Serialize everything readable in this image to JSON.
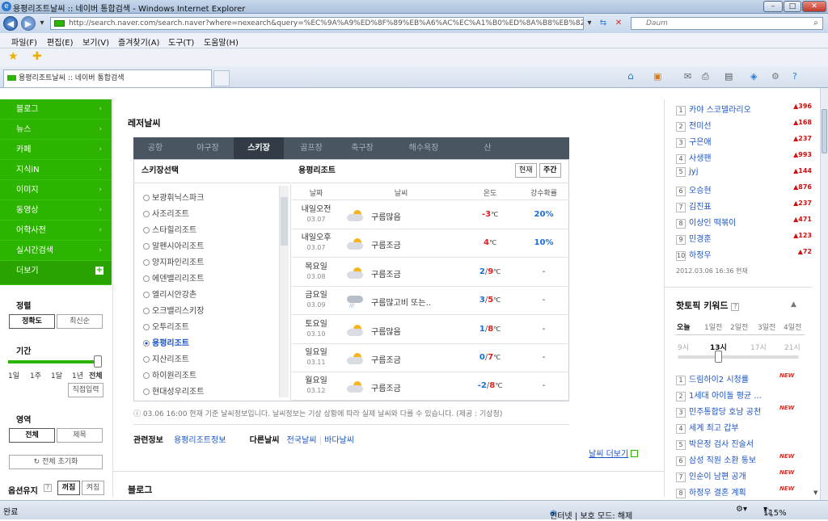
{
  "window": {
    "title": "용평리조트날씨 :: 네이버 통합검색 - Windows Internet Explorer",
    "min": "–",
    "max": "□",
    "close": "✕"
  },
  "address": {
    "url": "http://search.naver.com/search.naver?where=nexearch&query=%EC%9A%A9%ED%8F%89%EB%A6%AC%EC%A1%B0%ED%8A%B8%EB%82%A0%EC%94%A8",
    "search_placeholder": "Daum"
  },
  "menu": [
    "파일(F)",
    "편집(E)",
    "보기(V)",
    "즐겨찾기(A)",
    "도구(T)",
    "도움말(H)"
  ],
  "tab": {
    "label": "용평리조트날씨 :: 네이버 통합검색"
  },
  "left_nav": {
    "items": [
      "블로그",
      "뉴스",
      "카페",
      "지식iN",
      "이미지",
      "동영상",
      "어학사전",
      "실시간검색"
    ],
    "more": "더보기",
    "sort_title": "정렬",
    "sort_options": [
      "정확도",
      "최신순"
    ],
    "period_title": "기간",
    "period_ticks": [
      "1일",
      "1주",
      "1달",
      "1년",
      "전체"
    ],
    "direct_input": "직접입력",
    "area_title": "영역",
    "area_options": [
      "전체",
      "제목"
    ],
    "reset": "전체 초기화",
    "option_keep": "옵션유지",
    "option_off": "꺼짐",
    "option_on": "켜짐"
  },
  "leisure": {
    "title": "레저날씨",
    "tabs": [
      "공항",
      "야구장",
      "스키장",
      "골프장",
      "축구장",
      "해수욕장",
      "산"
    ],
    "active_tab": "스키장",
    "list_header": "스키장선택",
    "resorts": [
      "보광휘닉스파크",
      "사조리조트",
      "스타힐리조트",
      "알펜시아리조트",
      "양지파인리조트",
      "에덴밸리리조트",
      "엘리시안강촌",
      "오크밸리스키장",
      "오투리조트",
      "용평리조트",
      "지산리조트",
      "하이원리조트",
      "현대성우리조트"
    ],
    "selected_resort": "용평리조트",
    "weather_header": "용평리조트",
    "btn_now": "현재",
    "btn_week": "주간",
    "columns": [
      "날짜",
      "날씨",
      "온도",
      "강수확률"
    ],
    "rows": [
      {
        "day": "내일오전",
        "date": "03.07",
        "icon": "cloudy-sun-icon",
        "desc": "구름많음",
        "temp": "-3",
        "unit": "℃",
        "rain": "20%"
      },
      {
        "day": "내일오후",
        "date": "03.07",
        "icon": "cloudy-sun-icon",
        "desc": "구름조금",
        "temp": "4",
        "unit": "℃",
        "rain": "10%"
      },
      {
        "day": "목요일",
        "date": "03.08",
        "icon": "cloudy-sun-icon",
        "desc": "구름조금",
        "tmin": "2",
        "tmax": "9",
        "unit": "℃",
        "rain": "-"
      },
      {
        "day": "금요일",
        "date": "03.09",
        "icon": "rain-icon",
        "desc": "구름많고비 또는..",
        "tmin": "3",
        "tmax": "5",
        "unit": "℃",
        "rain": "-"
      },
      {
        "day": "토요일",
        "date": "03.10",
        "icon": "cloudy-sun-icon",
        "desc": "구름많음",
        "tmin": "1",
        "tmax": "8",
        "unit": "℃",
        "rain": "-"
      },
      {
        "day": "일요일",
        "date": "03.11",
        "icon": "cloudy-sun-icon",
        "desc": "구름조금",
        "tmin": "0",
        "tmax": "7",
        "unit": "℃",
        "rain": "-"
      },
      {
        "day": "월요일",
        "date": "03.12",
        "icon": "cloudy-sun-icon",
        "desc": "구름조금",
        "tmin": "-2",
        "tmax": "8",
        "unit": "℃",
        "rain": "-"
      }
    ],
    "notice": "03.06 16:00 현재 기준 날씨정보입니다. 날씨정보는 기상 상황에 따라 실제 날씨와 다를 수 있습니다. (제공 : 기상청)",
    "related_label": "관련정보",
    "related_link": "용평리조트정보",
    "other_label": "다른날씨",
    "other_links": [
      "전국날씨",
      "바다날씨"
    ],
    "more_link": "날씨 더보기"
  },
  "blog_heading": "블로그",
  "ranking": {
    "items": [
      {
        "rank": "1",
        "name": "카야 스코델라리오",
        "val": "▲396"
      },
      {
        "rank": "2",
        "name": "전미선",
        "val": "▲168"
      },
      {
        "rank": "3",
        "name": "구은애",
        "val": "▲237"
      },
      {
        "rank": "4",
        "name": "사생팬",
        "val": "▲993"
      },
      {
        "rank": "5",
        "name": "jyj",
        "val": "▲144"
      },
      {
        "rank": "6",
        "name": "오승현",
        "val": "▲876"
      },
      {
        "rank": "7",
        "name": "김진표",
        "val": "▲237"
      },
      {
        "rank": "8",
        "name": "이상인 떡볶이",
        "val": "▲471"
      },
      {
        "rank": "9",
        "name": "민경훈",
        "val": "▲123"
      },
      {
        "rank": "10",
        "name": "하정우",
        "val": "▲72"
      }
    ],
    "timestamp": "2012.03.06 16:36 현재"
  },
  "hot": {
    "title": "핫토픽 키워드",
    "help": "?",
    "days": [
      "오늘",
      "1일전",
      "2일전",
      "3일전",
      "4일전"
    ],
    "hours": [
      "9시",
      "13시",
      "17시",
      "21시"
    ],
    "selected_hour": "13시",
    "items": [
      {
        "rank": "1",
        "name": "드림하이2 시청률",
        "badge": "NEW"
      },
      {
        "rank": "2",
        "name": "1세대 아이돌 평균 ...",
        "badge": ""
      },
      {
        "rank": "3",
        "name": "민주통합당 호남 공천",
        "badge": "NEW"
      },
      {
        "rank": "4",
        "name": "세계 최고 갑부",
        "badge": ""
      },
      {
        "rank": "5",
        "name": "박은정 검사 진술서",
        "badge": ""
      },
      {
        "rank": "6",
        "name": "삼성 직원 소환 통보",
        "badge": "NEW"
      },
      {
        "rank": "7",
        "name": "인순이 남편 공개",
        "badge": "NEW"
      },
      {
        "rank": "8",
        "name": "하정우 결혼 계획",
        "badge": "NEW"
      }
    ]
  },
  "status": {
    "left": "완료",
    "zone": "인터넷 | 보호 모드: 해제",
    "zoom": "115%"
  }
}
